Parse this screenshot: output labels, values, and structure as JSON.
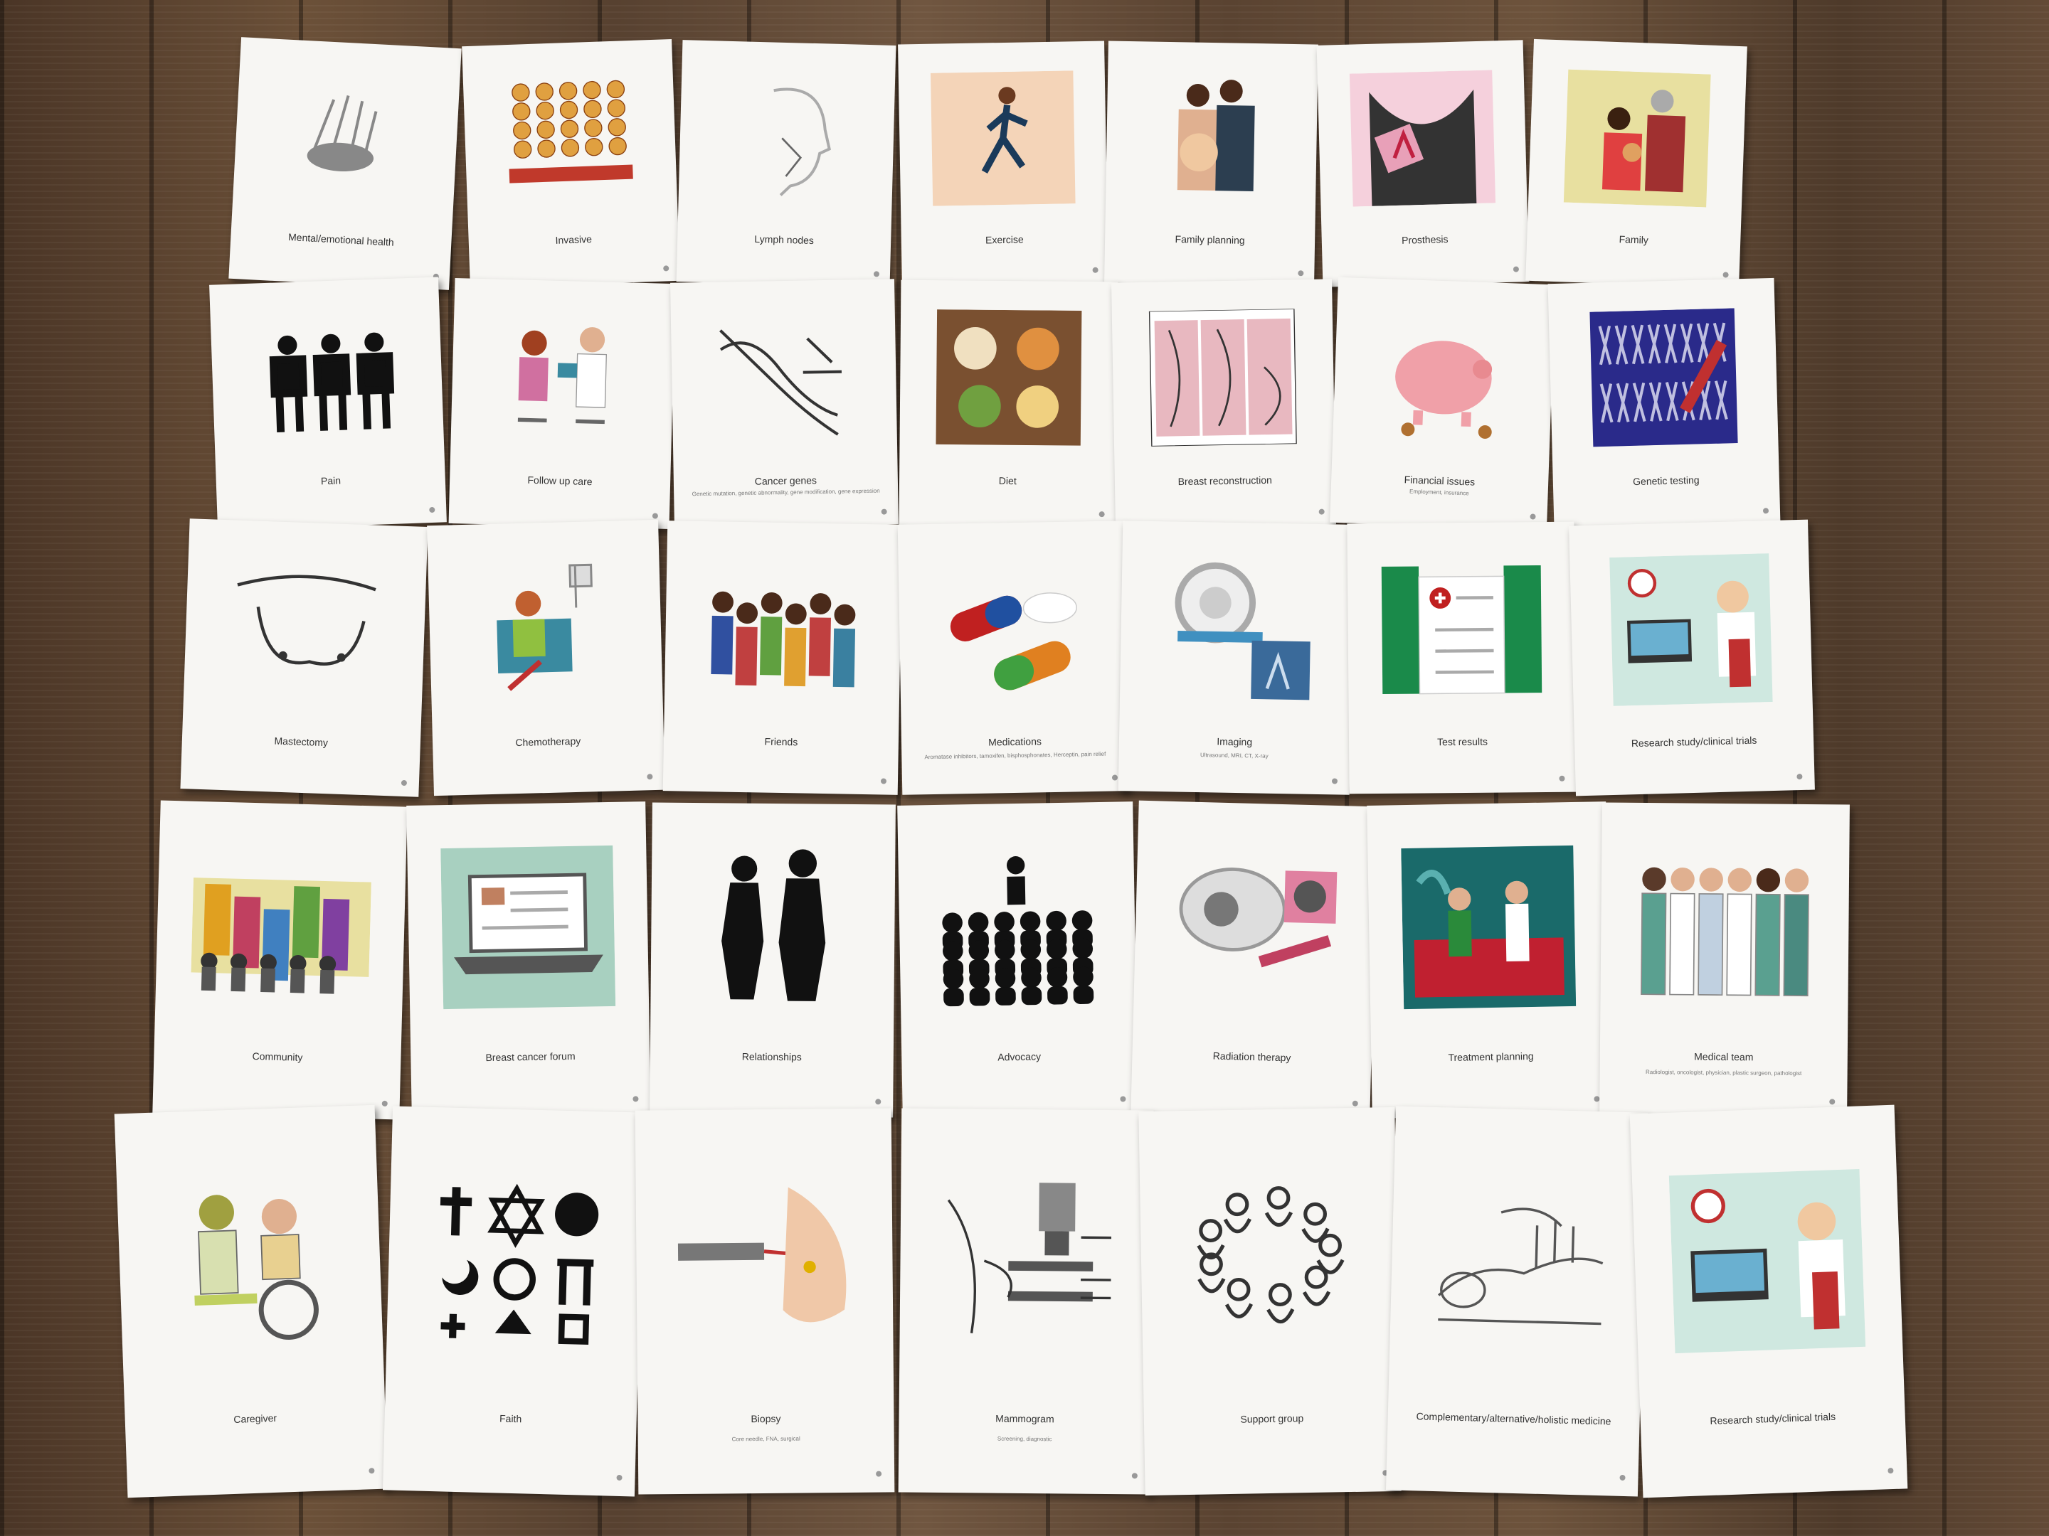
{
  "cards": [
    {
      "label": "Mental/emotional health",
      "sub": "",
      "icon": "hand-icon",
      "color": "#888888"
    },
    {
      "label": "Invasive",
      "sub": "",
      "icon": "cells-icon",
      "color": "#c0392b"
    },
    {
      "label": "Lymph nodes",
      "sub": "",
      "icon": "head-profile-icon",
      "color": "#aaaaaa"
    },
    {
      "label": "Exercise",
      "sub": "",
      "icon": "runner-icon",
      "color": "#f4d4b8"
    },
    {
      "label": "Family planning",
      "sub": "",
      "icon": "couple-icon",
      "color": "#2c3e50"
    },
    {
      "label": "Prosthesis",
      "sub": "",
      "icon": "ribbon-icon",
      "color": "#e8a0b8"
    },
    {
      "label": "Family",
      "sub": "",
      "icon": "family-icon",
      "color": "#e8e0a0"
    },
    {
      "label": "Pain",
      "sub": "",
      "icon": "pain-figures-icon",
      "color": "#111111"
    },
    {
      "label": "Follow up care",
      "sub": "",
      "icon": "doctor-patient-icon",
      "color": "#d070a0"
    },
    {
      "label": "Cancer genes",
      "sub": "Genetic mutation, genetic abnormality, gene modification, gene expression",
      "icon": "dna-icon",
      "color": "#333333"
    },
    {
      "label": "Diet",
      "sub": "",
      "icon": "food-icon",
      "color": "#7a5030"
    },
    {
      "label": "Breast reconstruction",
      "sub": "",
      "icon": "reconstruction-icon",
      "color": "#e8b8c0"
    },
    {
      "label": "Financial issues",
      "sub": "Employment, insurance",
      "icon": "piggy-bank-icon",
      "color": "#f0a0a8"
    },
    {
      "label": "Genetic testing",
      "sub": "",
      "icon": "chromosome-icon",
      "color": "#2a2a8a"
    },
    {
      "label": "Mastectomy",
      "sub": "",
      "icon": "mastectomy-icon",
      "color": "#333333"
    },
    {
      "label": "Chemotherapy",
      "sub": "",
      "icon": "iv-chair-icon",
      "color": "#3a8aa0"
    },
    {
      "label": "Friends",
      "sub": "",
      "icon": "friends-icon",
      "color": "#c04040"
    },
    {
      "label": "Medications",
      "sub": "Aromatase inhibitors, tamoxifen, bisphosphonates, Herceptin, pain relief",
      "icon": "pills-icon",
      "color": "#2050a0"
    },
    {
      "label": "Imaging",
      "sub": "Ultrasound, MRI, CT, X-ray",
      "icon": "mri-icon",
      "color": "#4090c0"
    },
    {
      "label": "Test results",
      "sub": "",
      "icon": "clipboard-icon",
      "color": "#1a8a4a"
    },
    {
      "label": "Research study/clinical trials",
      "sub": "",
      "icon": "lab-icon",
      "color": "#c03030"
    },
    {
      "label": "Community",
      "sub": "",
      "icon": "city-icon",
      "color": "#e0a020"
    },
    {
      "label": "Breast cancer forum",
      "sub": "",
      "icon": "laptop-icon",
      "color": "#a8d0c0"
    },
    {
      "label": "Relationships",
      "sub": "",
      "icon": "silhouettes-icon",
      "color": "#111111"
    },
    {
      "label": "Advocacy",
      "sub": "",
      "icon": "audience-icon",
      "color": "#111111"
    },
    {
      "label": "Radiation therapy",
      "sub": "",
      "icon": "radiation-machine-icon",
      "color": "#b0b0b0"
    },
    {
      "label": "Treatment planning",
      "sub": "",
      "icon": "team-meeting-icon",
      "color": "#1a6a6a"
    },
    {
      "label": "Medical team",
      "sub": "Radiologist, oncologist, physician, plastic surgeon, pathologist",
      "icon": "medical-team-icon",
      "color": "#5aa090"
    },
    {
      "label": "Caregiver",
      "sub": "",
      "icon": "wheelchair-icon",
      "color": "#c0d060"
    },
    {
      "label": "Faith",
      "sub": "",
      "icon": "religious-symbols-icon",
      "color": "#111111"
    },
    {
      "label": "Biopsy",
      "sub": "Core needle, FNA, surgical",
      "icon": "needle-icon",
      "color": "#f0c8a8"
    },
    {
      "label": "Mammogram",
      "sub": "Screening, diagnostic",
      "icon": "mammogram-machine-icon",
      "color": "#555555"
    },
    {
      "label": "Support group",
      "sub": "",
      "icon": "circle-group-icon",
      "color": "#333333"
    },
    {
      "label": "Complementary/alternative/holistic medicine",
      "sub": "",
      "icon": "acupuncture-icon",
      "color": "#555555"
    },
    {
      "label": "Research study/clinical trials",
      "sub": "",
      "icon": "lab-icon",
      "color": "#c03030"
    }
  ]
}
